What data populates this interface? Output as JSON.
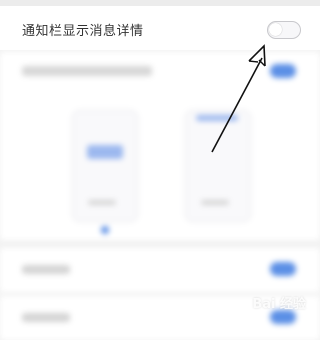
{
  "setting": {
    "label": "通知栏显示消息详情",
    "toggle_state": "off"
  },
  "colors": {
    "accent": "#5b8fe6",
    "toggle_border": "#c8c8cc",
    "card_bg": "#ffffff",
    "page_bg": "#f2f2f2"
  },
  "annotation": {
    "type": "arrow"
  },
  "watermark": {
    "text": "Bai 经验"
  }
}
